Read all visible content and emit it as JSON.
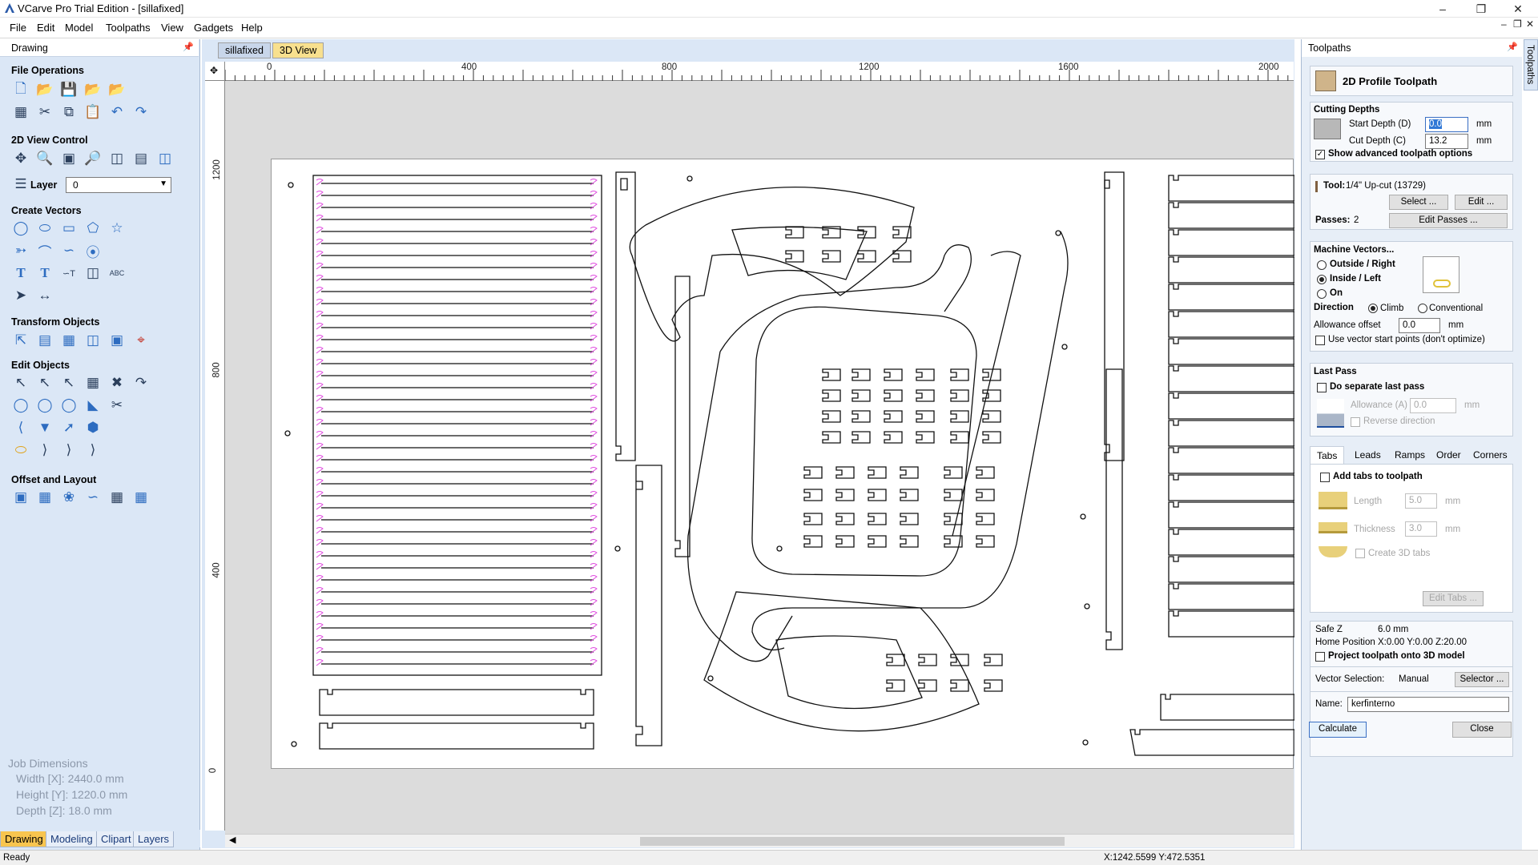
{
  "window": {
    "title": "VCarve Pro Trial Edition - [sillafixed]"
  },
  "menu": [
    "File",
    "Edit",
    "Model",
    "Toolpaths",
    "View",
    "Gadgets",
    "Help"
  ],
  "left_panel": {
    "title": "Drawing",
    "sections": {
      "file_ops": "File Operations",
      "view_control": "2D View Control",
      "layer_label": "Layer",
      "layer_value": "0",
      "create_vectors": "Create Vectors",
      "transform": "Transform Objects",
      "edit_objects": "Edit Objects",
      "offset_layout": "Offset and Layout"
    },
    "job_dimensions": {
      "title": "Job Dimensions",
      "width": "Width  [X]: 2440.0 mm",
      "height": "Height [Y]: 1220.0 mm",
      "depth": "Depth  [Z]: 18.0 mm"
    },
    "tabs": [
      "Drawing",
      "Modeling",
      "Clipart",
      "Layers"
    ]
  },
  "doc_tabs": [
    "sillafixed",
    "3D View"
  ],
  "ruler": {
    "h_labels": [
      "0",
      "400",
      "800",
      "1200",
      "1600",
      "2000"
    ],
    "v_labels": [
      "1200",
      "800",
      "400",
      "0"
    ]
  },
  "right_panel": {
    "title": "Toolpaths",
    "side_tab": "Toolpaths",
    "header": "2D Profile Toolpath",
    "cutting_depths": {
      "title": "Cutting Depths",
      "start_label": "Start Depth (D)",
      "start_value": "0.0",
      "cut_label": "Cut Depth (C)",
      "cut_value": "13.2",
      "unit": "mm",
      "show_advanced": "Show advanced toolpath options"
    },
    "tool": {
      "label": "Tool:",
      "value": "1/4\" Up-cut (13729)",
      "select_btn": "Select ...",
      "edit_btn": "Edit ..."
    },
    "passes": {
      "label": "Passes:",
      "value": "2",
      "edit_btn": "Edit Passes ..."
    },
    "machine_vectors": {
      "title": "Machine Vectors...",
      "outside": "Outside / Right",
      "inside": "Inside / Left",
      "on": "On",
      "direction": "Direction",
      "climb": "Climb",
      "conventional": "Conventional",
      "allowance_label": "Allowance offset",
      "allowance_value": "0.0",
      "unit": "mm",
      "use_start": "Use vector start points (don't optimize)"
    },
    "last_pass": {
      "title": "Last Pass",
      "separate": "Do separate last pass",
      "allowance_label": "Allowance (A)",
      "allowance_value": "0.0",
      "unit": "mm",
      "reverse": "Reverse direction"
    },
    "tabs_row": [
      "Tabs",
      "Leads",
      "Ramps",
      "Order",
      "Corners"
    ],
    "tabs_panel": {
      "add_tabs": "Add tabs to toolpath",
      "length_label": "Length",
      "length_value": "5.0",
      "thickness_label": "Thickness",
      "thickness_value": "3.0",
      "unit": "mm",
      "create_3d": "Create 3D tabs",
      "edit_tabs": "Edit Tabs ..."
    },
    "safe_z_label": "Safe Z",
    "safe_z_value": "6.0 mm",
    "home_label": "Home Position",
    "home_value": "X:0.00 Y:0.00 Z:20.00",
    "project": "Project toolpath onto 3D model",
    "vector_sel_label": "Vector Selection:",
    "vector_sel_value": "Manual",
    "selector_btn": "Selector ...",
    "name_label": "Name:",
    "name_value": "kerfinterno",
    "calculate": "Calculate",
    "close": "Close"
  },
  "status": {
    "left": "Ready",
    "coords": "X:1242.5599 Y:472.5351"
  }
}
